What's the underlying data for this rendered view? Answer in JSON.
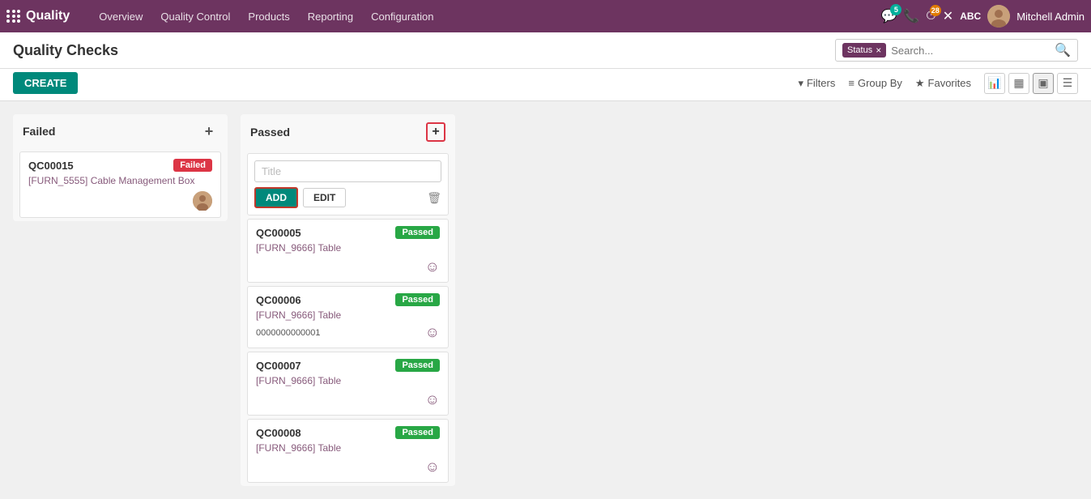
{
  "app": {
    "name": "Quality",
    "logo_label": "apps-icon"
  },
  "nav": {
    "items": [
      {
        "id": "overview",
        "label": "Overview"
      },
      {
        "id": "quality-control",
        "label": "Quality Control"
      },
      {
        "id": "products",
        "label": "Products"
      },
      {
        "id": "reporting",
        "label": "Reporting"
      },
      {
        "id": "configuration",
        "label": "Configuration"
      }
    ]
  },
  "nav_right": {
    "chat_badge": "5",
    "phone_label": "☎",
    "timer_badge": "28",
    "close_label": "✕",
    "abc_label": "ABC",
    "user_name": "Mitchell Admin"
  },
  "page": {
    "title": "Quality Checks"
  },
  "search": {
    "tag_label": "Status",
    "placeholder": "Search...",
    "tag_remove": "×"
  },
  "toolbar": {
    "create_label": "CREATE",
    "filters_label": "Filters",
    "group_by_label": "Group By",
    "favorites_label": "Favorites"
  },
  "view_icons": [
    {
      "id": "bar-chart",
      "icon": "▦",
      "active": false
    },
    {
      "id": "list-grid",
      "icon": "⊞",
      "active": false
    },
    {
      "id": "kanban",
      "icon": "▣",
      "active": true
    },
    {
      "id": "list",
      "icon": "≡",
      "active": false
    }
  ],
  "columns": [
    {
      "id": "failed",
      "label": "Failed",
      "cards": [
        {
          "id": "QC00015",
          "status": "Failed",
          "status_class": "status-failed",
          "product": "[FURN_5555] Cable Management Box",
          "has_avatar": true,
          "lot": ""
        }
      ]
    },
    {
      "id": "passed",
      "label": "Passed",
      "show_add_form": true,
      "cards": [
        {
          "id": "QC00005",
          "status": "Passed",
          "status_class": "status-passed",
          "product": "[FURN_9666] Table",
          "has_avatar": false,
          "lot": ""
        },
        {
          "id": "QC00006",
          "status": "Passed",
          "status_class": "status-passed",
          "product": "[FURN_9666] Table",
          "has_avatar": false,
          "lot": "0000000000001"
        },
        {
          "id": "QC00007",
          "status": "Passed",
          "status_class": "status-passed",
          "product": "[FURN_9666] Table",
          "has_avatar": false,
          "lot": ""
        },
        {
          "id": "QC00008",
          "status": "Passed",
          "status_class": "status-passed",
          "product": "[FURN_9666] Table",
          "has_avatar": false,
          "lot": ""
        }
      ]
    }
  ],
  "add_form": {
    "placeholder": "Title",
    "add_label": "ADD",
    "edit_label": "EDIT",
    "delete_icon": "🗑"
  }
}
